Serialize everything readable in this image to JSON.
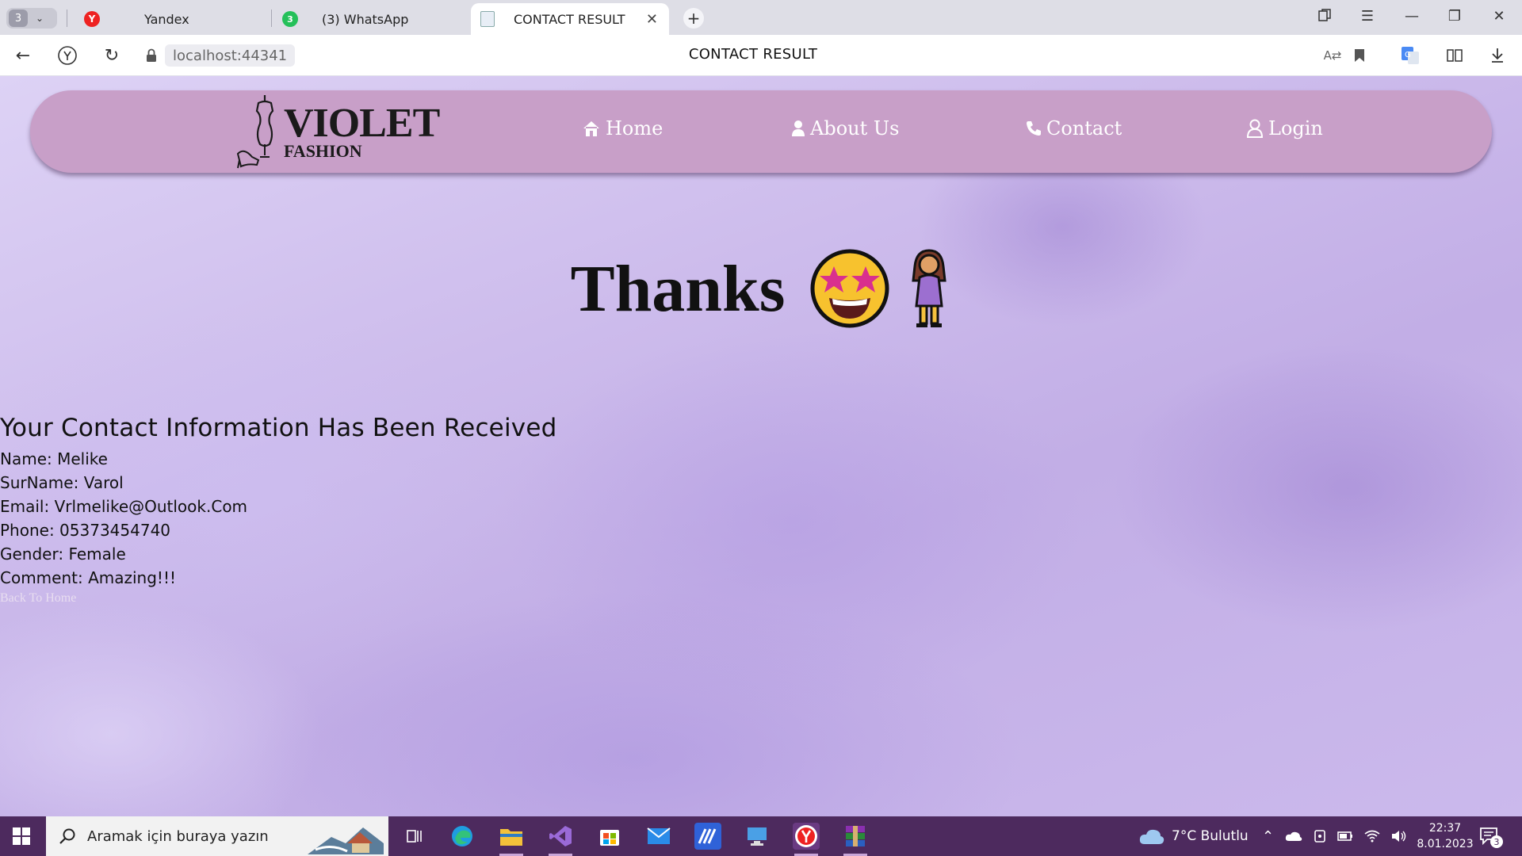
{
  "browser": {
    "tab_count": "3",
    "tabs": [
      {
        "title": "Yandex"
      },
      {
        "title": "(3) WhatsApp",
        "badge": "3"
      },
      {
        "title": "CONTACT RESULT"
      }
    ],
    "url": "localhost:44341",
    "page_title": "CONTACT RESULT"
  },
  "navbar": {
    "logo_main": "VIOLET",
    "logo_sub": "FASHION",
    "links": [
      {
        "label": "Home",
        "icon": "home-icon"
      },
      {
        "label": "About Us",
        "icon": "user-icon"
      },
      {
        "label": "Contact",
        "icon": "phone-icon"
      },
      {
        "label": "Login",
        "icon": "user-outline-icon"
      }
    ]
  },
  "content": {
    "heading": "Thanks",
    "emojis": [
      "🤩",
      "🧍‍♀️"
    ],
    "subheading": "Your Contact Information Has Been Received",
    "lines": [
      "Name: Melike",
      "SurName: Varol",
      "Email: Vrlmelike@Outlook.Com",
      "Phone: 05373454740",
      "Gender: Female",
      "Comment: Amazing!!!"
    ],
    "back_link": "Back To Home"
  },
  "taskbar": {
    "search_placeholder": "Aramak için buraya yazın",
    "weather": "7°C  Bulutlu",
    "time": "22:37",
    "date": "8.01.2023",
    "notification_count": "3"
  },
  "colors": {
    "navbar": "#c89fc8",
    "taskbar": "#4d2a5e",
    "page_background": "#cdbcec"
  }
}
